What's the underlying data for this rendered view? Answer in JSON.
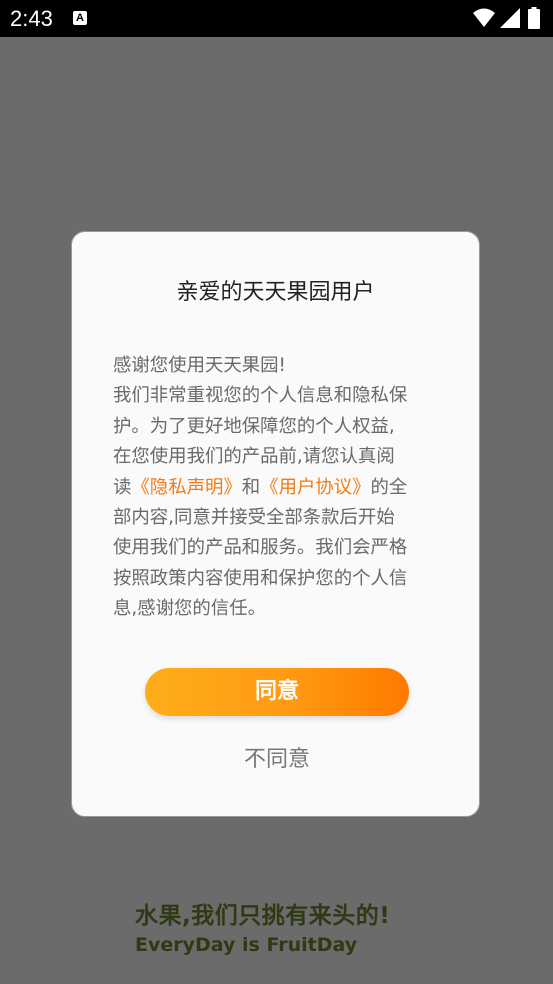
{
  "status_bar": {
    "time": "2:43",
    "notification_icon": "a-badge-icon",
    "wifi_icon": "wifi-icon",
    "signal_icon": "cell-signal-icon",
    "battery_icon": "battery-icon"
  },
  "dialog": {
    "title": "亲爱的天天果园用户",
    "body": {
      "line1": "感谢您使用天天果园!",
      "line2": "我们非常重视您的个人信息和隐私保",
      "line3": "护。为了更好地保障您的个人权益,",
      "line4": "在您使用我们的产品前,请您认真阅",
      "line5_prefix": "读",
      "privacy_link": "《隐私声明》",
      "line5_mid": "和",
      "agreement_link": "《用户协议》",
      "line5_suffix": "的全",
      "line6": "部内容,同意并接受全部条款后开始",
      "line7": "使用我们的产品和服务。我们会严格",
      "line8": "按照政策内容使用和保护您的个人信",
      "line9": "息,感谢您的信任。"
    },
    "agree_label": "同意",
    "disagree_label": "不同意"
  },
  "footer": {
    "slogan_cn": "水果,我们只挑有来头的!",
    "slogan_en": "EveryDay is FruitDay"
  },
  "colors": {
    "link": "#f07c16",
    "button_start": "#ffad1a",
    "button_end": "#ff7a00",
    "overlay": "#6b6b6b",
    "slogan": "#2f3a14"
  }
}
